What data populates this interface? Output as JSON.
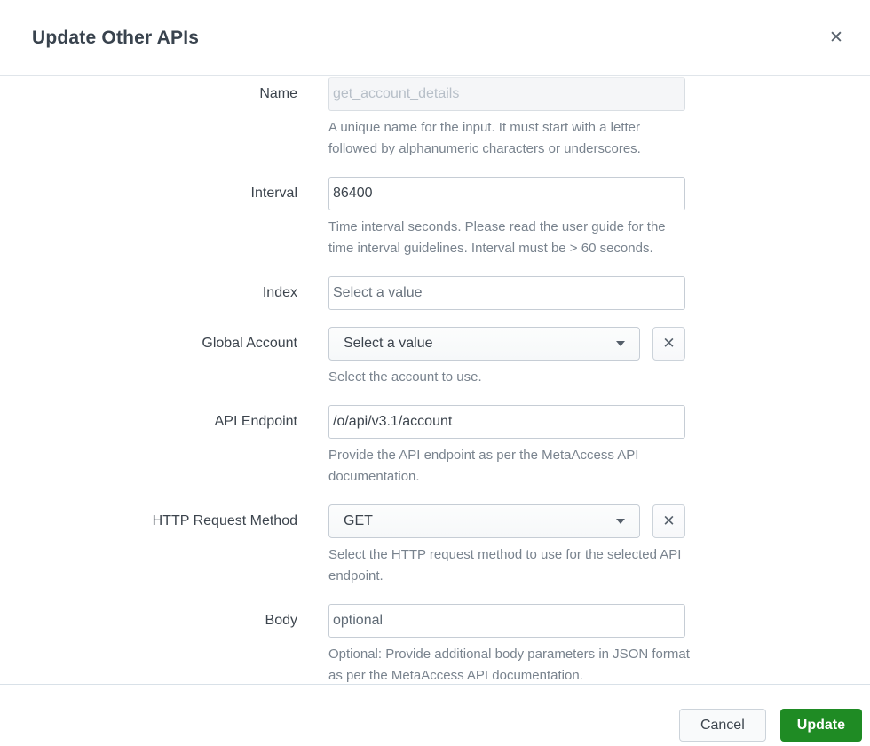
{
  "modal": {
    "title": "Update Other APIs",
    "close_icon": "✕"
  },
  "form": {
    "name": {
      "label": "Name",
      "value": "get_account_details",
      "disabled": true,
      "help": "A unique name for the input. It must start with a letter followed by alphanumeric characters or underscores."
    },
    "interval": {
      "label": "Interval",
      "value": "86400",
      "help": "Time interval seconds. Please read the user guide for the time interval guidelines. Interval must be > 60 seconds."
    },
    "index": {
      "label": "Index",
      "placeholder": "Select a value"
    },
    "global_account": {
      "label": "Global Account",
      "selected_value": "Select a value",
      "help": "Select the account to use.",
      "caret_icon": "chevron-down",
      "clear_icon": "✕"
    },
    "api_endpoint": {
      "label": "API Endpoint",
      "value": "/o/api/v3.1/account",
      "help": "Provide the API endpoint as per the MetaAccess API documentation."
    },
    "http_method": {
      "label": "HTTP Request Method",
      "selected_value": "GET",
      "help": "Select the HTTP request method to use for the selected API endpoint.",
      "caret_icon": "chevron-down",
      "clear_icon": "✕"
    },
    "body": {
      "label": "Body",
      "placeholder": "optional",
      "help": "Optional: Provide additional body parameters in JSON format as per the MetaAccess API documentation."
    }
  },
  "footer": {
    "cancel_label": "Cancel",
    "update_label": "Update"
  },
  "colors": {
    "update_button_green": "#1f8b24",
    "text_dark": "#3c444d",
    "help_gray": "#79838e",
    "border_gray": "#c6cdd5"
  }
}
